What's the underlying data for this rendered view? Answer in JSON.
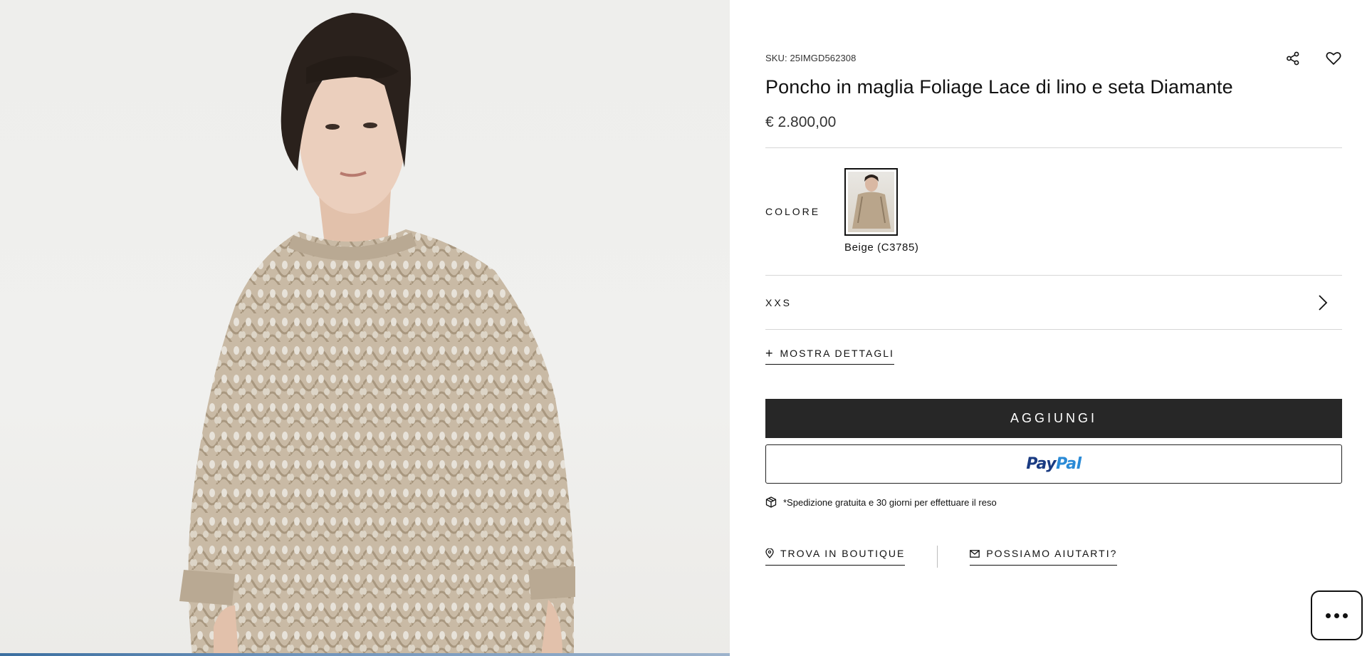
{
  "product": {
    "sku": "SKU: 25IMGD562308",
    "title": "Poncho in maglia Foliage Lace di lino e seta Diamante",
    "price": "€ 2.800,00"
  },
  "color": {
    "label": "COLORE",
    "selected_name": "Beige (C3785)"
  },
  "size": {
    "selected": "XXS"
  },
  "details": {
    "toggle_symbol": "+",
    "toggle_label": "MOSTRA DETTAGLI"
  },
  "actions": {
    "add_label": "AGGIUNGI",
    "paypal_part1": "Pay",
    "paypal_part2": "Pal"
  },
  "shipping": {
    "text": "*Spedizione gratuita e 30 giorni per effettuare il reso"
  },
  "links": {
    "boutique": "TROVA IN BOUTIQUE",
    "help": "POSSIAMO AIUTARTI?"
  },
  "icons": {
    "share": "share-icon",
    "wishlist": "heart-icon",
    "chevron": "chevron-right-icon",
    "shipping": "package-icon",
    "boutique": "location-pin-icon",
    "help": "envelope-icon",
    "chat": "chat-bubble-icon"
  },
  "colors": {
    "add_button_bg": "#272727",
    "paypal_dark": "#1a3b82",
    "paypal_light": "#2a8ad6",
    "knit_beige": "#c8b9a4"
  }
}
